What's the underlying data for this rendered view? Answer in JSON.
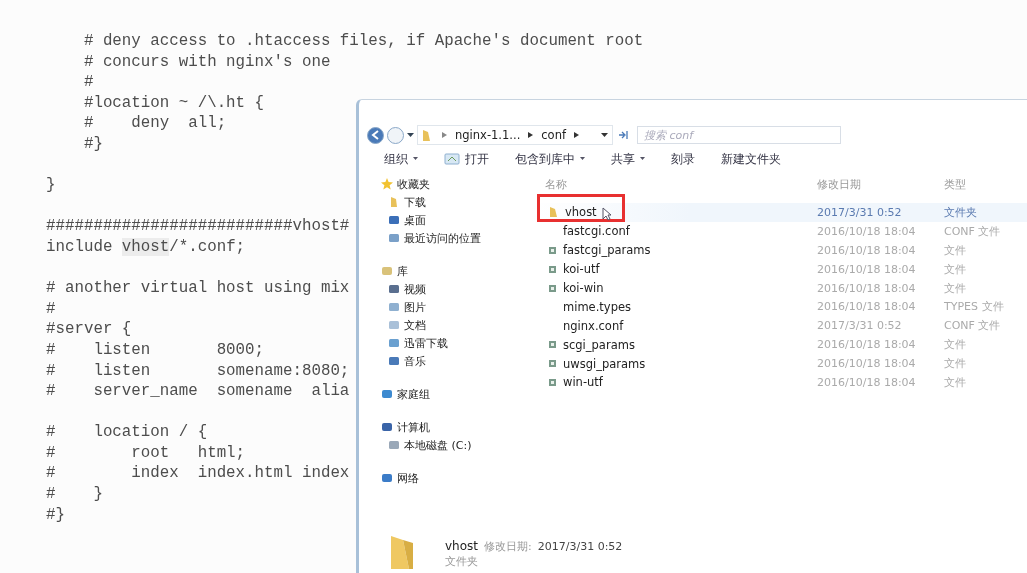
{
  "editor": {
    "blocks": [
      [
        {
          "segments": [
            {
              "text": "    # deny access to .htaccess files, if Apache's document root"
            }
          ]
        },
        {
          "segments": [
            {
              "text": "    # concurs with nginx's one"
            }
          ]
        },
        {
          "segments": [
            {
              "text": "    #"
            }
          ]
        },
        {
          "segments": [
            {
              "text": "    #location ~ /\\.ht {"
            }
          ]
        },
        {
          "segments": [
            {
              "text": "    #    deny  all;"
            }
          ]
        },
        {
          "segments": [
            {
              "text": "    #}"
            }
          ]
        }
      ],
      [
        {
          "segments": [
            {
              "text": "}"
            }
          ]
        }
      ],
      [
        {
          "segments": [
            {
              "text": "##########################vhost#"
            }
          ]
        },
        {
          "segments": [
            {
              "text": "include "
            },
            {
              "text": "vhost",
              "highlighted": true
            },
            {
              "text": "/*.conf;"
            }
          ]
        }
      ],
      [
        {
          "segments": [
            {
              "text": "# another virtual host using mix"
            }
          ]
        },
        {
          "segments": [
            {
              "text": "#"
            }
          ]
        },
        {
          "segments": [
            {
              "text": "#server {"
            }
          ]
        },
        {
          "segments": [
            {
              "text": "#    listen       8000;"
            }
          ]
        },
        {
          "segments": [
            {
              "text": "#    listen       somename:8080;"
            }
          ]
        },
        {
          "segments": [
            {
              "text": "#    server_name  somename  alia"
            }
          ]
        }
      ],
      [
        {
          "segments": [
            {
              "text": "#    location / {"
            }
          ]
        },
        {
          "segments": [
            {
              "text": "#        root   html;"
            }
          ]
        },
        {
          "segments": [
            {
              "text": "#        index  index.html index"
            }
          ]
        },
        {
          "segments": [
            {
              "text": "#    }"
            }
          ]
        },
        {
          "segments": [
            {
              "text": "#}"
            }
          ]
        }
      ]
    ]
  },
  "explorer": {
    "address": {
      "crumbs": [
        "nginx-1.1...",
        "conf"
      ],
      "search_placeholder": "搜索 conf"
    },
    "toolbar": [
      {
        "label": "组织",
        "dropdown": true,
        "icon": false
      },
      {
        "label": "打开",
        "dropdown": false,
        "icon": true
      },
      {
        "label": "包含到库中",
        "dropdown": true,
        "icon": false
      },
      {
        "label": "共享",
        "dropdown": true,
        "icon": false
      },
      {
        "label": "刻录",
        "dropdown": false,
        "icon": false
      },
      {
        "label": "新建文件夹",
        "dropdown": false,
        "icon": false
      }
    ],
    "navigation": [
      {
        "label": "收藏夹",
        "kind": "star",
        "children": [
          {
            "label": "下载",
            "kind": "folder"
          },
          {
            "label": "桌面",
            "kind": "desktop"
          },
          {
            "label": "最近访问的位置",
            "kind": "recent"
          }
        ]
      },
      {
        "label": "库",
        "kind": "library",
        "children": [
          {
            "label": "视频",
            "kind": "video"
          },
          {
            "label": "图片",
            "kind": "image"
          },
          {
            "label": "文档",
            "kind": "document"
          },
          {
            "label": "迅雷下载",
            "kind": "download"
          },
          {
            "label": "音乐",
            "kind": "music"
          }
        ]
      },
      {
        "label": "家庭组",
        "kind": "homegroup"
      },
      {
        "label": "计算机",
        "kind": "computer",
        "children": [
          {
            "label": "本地磁盘 (C:)",
            "kind": "drive"
          }
        ]
      },
      {
        "label": "网络",
        "kind": "network"
      }
    ],
    "columns": [
      "名称",
      "修改日期",
      "类型"
    ],
    "files": [
      {
        "name": "vhost",
        "date": "2017/3/31 0:52",
        "type": "文件夹",
        "kind": "folder",
        "selected": true,
        "marked": true
      },
      {
        "name": "fastcgi.conf",
        "date": "2016/10/18 18:04",
        "type": "CONF 文件",
        "kind": "plain",
        "selected": false,
        "marked": false
      },
      {
        "name": "fastcgi_params",
        "date": "2016/10/18 18:04",
        "type": "文件",
        "kind": "file",
        "selected": false,
        "marked": false
      },
      {
        "name": "koi-utf",
        "date": "2016/10/18 18:04",
        "type": "文件",
        "kind": "file",
        "selected": false,
        "marked": false
      },
      {
        "name": "koi-win",
        "date": "2016/10/18 18:04",
        "type": "文件",
        "kind": "file",
        "selected": false,
        "marked": false
      },
      {
        "name": "mime.types",
        "date": "2016/10/18 18:04",
        "type": "TYPES 文件",
        "kind": "plain",
        "selected": false,
        "marked": false
      },
      {
        "name": "nginx.conf",
        "date": "2017/3/31 0:52",
        "type": "CONF 文件",
        "kind": "plain",
        "selected": false,
        "marked": false
      },
      {
        "name": "scgi_params",
        "date": "2016/10/18 18:04",
        "type": "文件",
        "kind": "file",
        "selected": false,
        "marked": false
      },
      {
        "name": "uwsgi_params",
        "date": "2016/10/18 18:04",
        "type": "文件",
        "kind": "file",
        "selected": false,
        "marked": false
      },
      {
        "name": "win-utf",
        "date": "2016/10/18 18:04",
        "type": "文件",
        "kind": "file",
        "selected": false,
        "marked": false
      }
    ],
    "details": {
      "name": "vhost",
      "date_label": "修改日期:",
      "date": "2017/3/31 0:52",
      "type": "文件夹"
    }
  }
}
